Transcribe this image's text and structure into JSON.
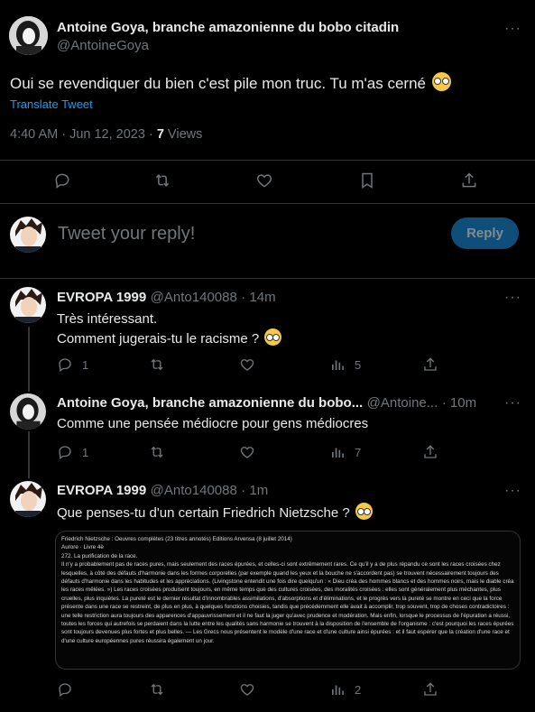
{
  "main_tweet": {
    "name": "Antoine Goya, branche amazonienne du bobo citadin",
    "handle": "@AntoineGoya",
    "text": "Oui se revendiquer du bien c'est pile mon truc. Tu m'as cerné",
    "translate": "Translate Tweet",
    "timestamp": "4:40 AM · Jun 12, 2023 · ",
    "views_count": "7",
    "views_label": " Views"
  },
  "reply_box": {
    "placeholder": "Tweet your reply!",
    "button": "Reply"
  },
  "replies": [
    {
      "name": "EVROPA 1999",
      "handle": "@Anto140088",
      "time": "· 14m",
      "lines": [
        "Très intéressant.",
        "Comment jugerais-tu le racisme ?"
      ],
      "reply_count": "1",
      "views": "5"
    },
    {
      "name": "Antoine Goya, branche amazonienne du bobo...",
      "handle": "@Antoine...",
      "time": "· 10m",
      "lines": [
        "Comme une pensée médiocre pour gens médiocres"
      ],
      "reply_count": "1",
      "views": "7"
    },
    {
      "name": "EVROPA 1999",
      "handle": "@Anto140088",
      "time": "· 1m",
      "lines": [
        "Que penses-tu d'un certain Friedrich Nietzsche ?"
      ],
      "reply_count": "",
      "views": "2"
    }
  ],
  "excerpt": {
    "header": "Friedrich Nietzsche : Oeuvres complètes (23 titres annotés) Editions Arvensa (8 juillet 2014)",
    "book": "Aurore · Livre 4è",
    "section": "272. La purification de la race.",
    "body": "Il n'y a probablement pas de races pures, mais seulement des races épurées, et celles-ci sont extrêmement rares. Ce qu'il y a de plus répandu ce sont les races croisées chez lesquelles, à côté des défauts d'harmonie dans les formes corporelles (par exemple quand les yeux et la bouche ne s'accordent pas) se trouvent nécessairement toujours des défauts d'harmonie dans les habitudes et les appréciations. (Livingstone entendit une fois dire quelqu'un : « Dieu créa des hommes blancs et des hommes noirs, mais le diable créa les races mêlées. ») Les races croisées produisent toujours, en même temps que des cultures croisées, des moralités croisées : elles sont généralement plus méchantes, plus cruelles, plus inquiètes. La pureté est le dernier résultat d'innombrables assimilations, d'absorptions et d'éliminations, et le progrès vers la pureté se montre en ceci que la force présente dans une race se restreint, de plus en plus, à quelques fonctions choisies, tandis que précédemment elle avait à accomplir, trop souvent, trop de choses contradictoires : une telle restriction aura toujours des apparences d'appauvrissement et il ne faut la juger qu'avec prudence et modération. Mais enfin, lorsque le processus de l'épuration a réussi, toutes les forces qui autrefois se perdaient dans la lutte entre les qualités sans harmonie se trouvent à la disposition de l'ensemble de l'organisme : c'est pourquoi les races épurées sont toujours devenues plus fortes et plus belles. — Les Grecs nous présentent le modèle d'une race et d'une culture ainsi épurées : et il faut espérer que la création d'une race et d'une culture européennes pures réussira également un jour."
  },
  "colors": {
    "background": "#000000",
    "text": "#e7e9ea",
    "muted": "#71767b",
    "link": "#1d9bf0",
    "reply_button": "#0f4e78",
    "divider": "#2f3336"
  },
  "icons": [
    "more-icon",
    "reply-icon",
    "retweet-icon",
    "like-icon",
    "bookmark-icon",
    "share-icon",
    "views-icon",
    "emoji-nerd-icon"
  ]
}
